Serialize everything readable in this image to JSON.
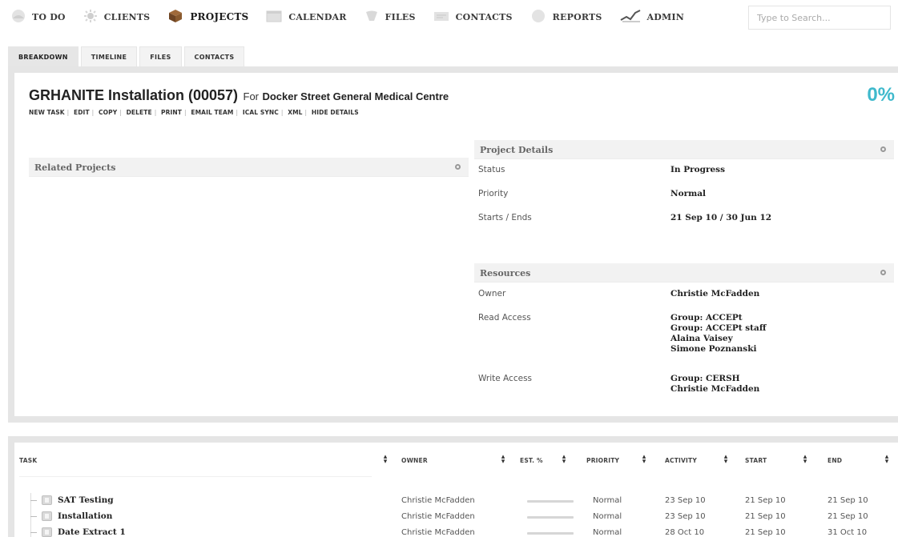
{
  "nav": {
    "items": [
      {
        "label": "TO DO",
        "icon": "todo-circle-icon",
        "active": false
      },
      {
        "label": "CLIENTS",
        "icon": "clients-icon",
        "active": false
      },
      {
        "label": "PROJECTS",
        "icon": "projects-box-icon",
        "active": true
      },
      {
        "label": "CALENDAR",
        "icon": "calendar-icon",
        "active": false
      },
      {
        "label": "FILES",
        "icon": "files-icon",
        "active": false
      },
      {
        "label": "CONTACTS",
        "icon": "contacts-icon",
        "active": false
      },
      {
        "label": "REPORTS",
        "icon": "reports-icon",
        "active": false
      },
      {
        "label": "ADMIN",
        "icon": "admin-icon",
        "active": false
      }
    ],
    "search_placeholder": "Type to Search..."
  },
  "subtabs": [
    {
      "label": "BREAKDOWN",
      "active": true
    },
    {
      "label": "TIMELINE",
      "active": false
    },
    {
      "label": "FILES",
      "active": false
    },
    {
      "label": "CONTACTS",
      "active": false
    }
  ],
  "project": {
    "name": "GRHANITE Installation (00057)",
    "for_label": "For",
    "client": "Docker Street General Medical Centre",
    "percent": "0%",
    "actions": [
      "NEW TASK",
      "EDIT",
      "COPY",
      "DELETE",
      "PRINT",
      "EMAIL TEAM",
      "ICAL SYNC",
      "XML",
      "HIDE DETAILS"
    ]
  },
  "related": {
    "title": "Related Projects"
  },
  "details": {
    "title": "Project Details",
    "rows": [
      {
        "label": "Status",
        "value": "In Progress"
      },
      {
        "label": "Priority",
        "value": "Normal"
      },
      {
        "label": "Starts / Ends",
        "value": "21 Sep 10 / 30 Jun 12"
      }
    ]
  },
  "resources": {
    "title": "Resources",
    "owner_label": "Owner",
    "owner": "Christie McFadden",
    "read_label": "Read Access",
    "read": [
      "Group: ACCEPt",
      "Group: ACCEPt staff",
      "Alaina Vaisey",
      "Simone Poznanski"
    ],
    "write_label": "Write Access",
    "write": [
      "Group: CERSH",
      "Christie McFadden"
    ]
  },
  "tasks": {
    "headers": {
      "task": "TASK",
      "owner": "OWNER",
      "est": "EST. %",
      "priority": "PRIORITY",
      "activity": "ACTIVITY",
      "start": "START",
      "end": "END"
    },
    "rows": [
      {
        "name": "SAT Testing",
        "owner": "Christie McFadden",
        "est": 0,
        "priority": "Normal",
        "activity": "23 Sep 10",
        "start": "21 Sep 10",
        "end": "21 Sep 10"
      },
      {
        "name": "Installation",
        "owner": "Christie McFadden",
        "est": 0,
        "priority": "Normal",
        "activity": "23 Sep 10",
        "start": "21 Sep 10",
        "end": "21 Sep 10"
      },
      {
        "name": "Date Extract 1",
        "owner": "Christie McFadden",
        "est": 0,
        "priority": "Normal",
        "activity": "28 Oct 10",
        "start": "21 Sep 10",
        "end": "31 Oct 10"
      }
    ]
  }
}
